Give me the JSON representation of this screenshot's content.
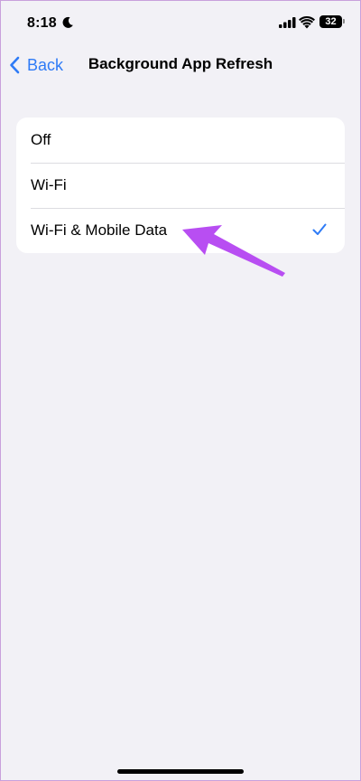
{
  "status_bar": {
    "time": "8:18",
    "battery": "32",
    "icons": [
      "moon-icon",
      "signal-icon",
      "wifi-icon",
      "battery-icon"
    ]
  },
  "nav": {
    "back_label": "Back",
    "title": "Background App Refresh"
  },
  "options": [
    {
      "label": "Off",
      "selected": false
    },
    {
      "label": "Wi-Fi",
      "selected": false
    },
    {
      "label": "Wi-Fi & Mobile Data",
      "selected": true
    }
  ],
  "colors": {
    "accent": "#2f7bf6",
    "background": "#f2f1f6",
    "annotation": "#b84ef2"
  }
}
